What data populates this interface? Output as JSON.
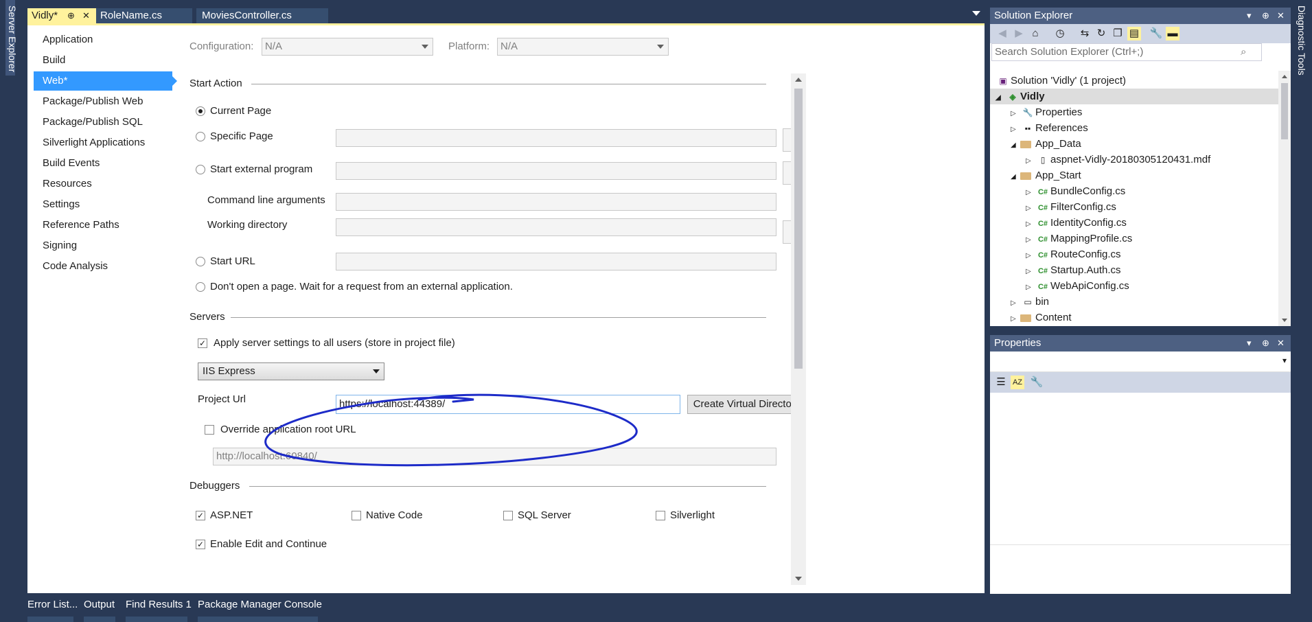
{
  "left_rail": {
    "label": "Server Explorer"
  },
  "right_rail": {
    "label": "Diagnostic Tools"
  },
  "doc_tabs": [
    {
      "label": "Vidly*",
      "active": true
    },
    {
      "label": "RoleName.cs",
      "active": false
    },
    {
      "label": "MoviesController.cs",
      "active": false
    }
  ],
  "nav": {
    "items": [
      "Application",
      "Build",
      "Web*",
      "Package/Publish Web",
      "Package/Publish SQL",
      "Silverlight Applications",
      "Build Events",
      "Resources",
      "Settings",
      "Reference Paths",
      "Signing",
      "Code Analysis"
    ],
    "selected": "Web*"
  },
  "config_bar": {
    "configuration_label": "Configuration:",
    "configuration_value": "N/A",
    "platform_label": "Platform:",
    "platform_value": "N/A"
  },
  "start_action": {
    "heading": "Start Action",
    "current_page": "Current Page",
    "specific_page": "Specific Page",
    "external_program": "Start external program",
    "command_line": "Command line arguments",
    "working_dir": "Working directory",
    "start_url": "Start URL",
    "dont_open": "Don't open a page.  Wait for a request from an external application.",
    "selected": "Current Page",
    "browse": "..."
  },
  "servers": {
    "heading": "Servers",
    "apply_all": "Apply server settings to all users (store in project file)",
    "apply_all_checked": true,
    "server": "IIS Express",
    "project_url_label": "Project Url",
    "project_url": "https://localhost:44389/",
    "create_vdir": "Create Virtual Directory",
    "override_root": "Override application root URL",
    "override_checked": false,
    "override_url": "http://localhost:60840/"
  },
  "debuggers": {
    "heading": "Debuggers",
    "items": [
      {
        "label": "ASP.NET",
        "checked": true
      },
      {
        "label": "Native Code",
        "checked": false
      },
      {
        "label": "SQL Server",
        "checked": false
      },
      {
        "label": "Silverlight",
        "checked": false
      }
    ],
    "edit_continue": "Enable Edit and Continue",
    "edit_continue_checked": true
  },
  "solution_explorer": {
    "title": "Solution Explorer",
    "search_placeholder": "Search Solution Explorer (Ctrl+;)",
    "tree": [
      {
        "label": "Solution 'Vidly' (1 project)",
        "level": 0,
        "kind": "solution"
      },
      {
        "label": "Vidly",
        "level": 0,
        "kind": "project",
        "bold": true
      },
      {
        "label": "Properties",
        "level": 1,
        "kind": "properties"
      },
      {
        "label": "References",
        "level": 1,
        "kind": "references"
      },
      {
        "label": "App_Data",
        "level": 1,
        "kind": "folder"
      },
      {
        "label": "aspnet-Vidly-20180305120431.mdf",
        "level": 2,
        "kind": "file"
      },
      {
        "label": "App_Start",
        "level": 1,
        "kind": "folder"
      },
      {
        "label": "BundleConfig.cs",
        "level": 2,
        "kind": "cs"
      },
      {
        "label": "FilterConfig.cs",
        "level": 2,
        "kind": "cs"
      },
      {
        "label": "IdentityConfig.cs",
        "level": 2,
        "kind": "cs"
      },
      {
        "label": "MappingProfile.cs",
        "level": 2,
        "kind": "cs"
      },
      {
        "label": "RouteConfig.cs",
        "level": 2,
        "kind": "cs"
      },
      {
        "label": "Startup.Auth.cs",
        "level": 2,
        "kind": "cs"
      },
      {
        "label": "WebApiConfig.cs",
        "level": 2,
        "kind": "cs"
      },
      {
        "label": "bin",
        "level": 1,
        "kind": "file-plain"
      },
      {
        "label": "Content",
        "level": 1,
        "kind": "folder"
      }
    ]
  },
  "properties_panel": {
    "title": "Properties"
  },
  "bottom_tabs": [
    "Error List...",
    "Output",
    "Find Results 1",
    "Package Manager Console"
  ],
  "glyphs": {
    "pin": "⊕",
    "close": "✕",
    "dropdown": "▾",
    "cs": "C#"
  },
  "colors": {
    "accent_tab": "#fff29d",
    "selection": "#3399ff",
    "chrome": "#293955",
    "annotation_ink": "#1d2bc8"
  }
}
